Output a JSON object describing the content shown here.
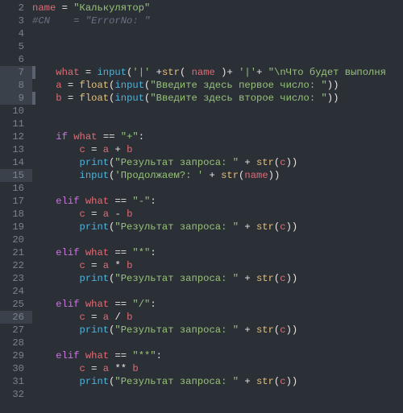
{
  "lines": [
    {
      "n": 2,
      "cls": "",
      "tokens": [
        {
          "c": "var",
          "t": "name"
        },
        {
          "c": "op",
          "t": " = "
        },
        {
          "c": "str",
          "t": "\"Калькулятор\""
        }
      ]
    },
    {
      "n": 3,
      "cls": "",
      "tokens": [
        {
          "c": "cmt",
          "t": "#CN    = \"ErrorNo: \""
        }
      ]
    },
    {
      "n": 4,
      "cls": "",
      "tokens": [
        {
          "c": "op",
          "t": ""
        }
      ]
    },
    {
      "n": 5,
      "cls": "",
      "tokens": [
        {
          "c": "op",
          "t": ""
        }
      ]
    },
    {
      "n": 6,
      "cls": "",
      "tokens": [
        {
          "c": "op",
          "t": ""
        }
      ]
    },
    {
      "n": 7,
      "cls": "hl0",
      "tokens": [
        {
          "c": "op",
          "t": "    "
        },
        {
          "c": "var",
          "t": "what"
        },
        {
          "c": "op",
          "t": " = "
        },
        {
          "c": "fn",
          "t": "input"
        },
        {
          "c": "op",
          "t": "("
        },
        {
          "c": "str",
          "t": "'|'"
        },
        {
          "c": "op",
          "t": " +"
        },
        {
          "c": "ty",
          "t": "str"
        },
        {
          "c": "op",
          "t": "( "
        },
        {
          "c": "var",
          "t": "name"
        },
        {
          "c": "op",
          "t": " )+ "
        },
        {
          "c": "str",
          "t": "'|'"
        },
        {
          "c": "op",
          "t": "+ "
        },
        {
          "c": "str",
          "t": "\"\\nЧто будет выполня"
        }
      ]
    },
    {
      "n": 8,
      "cls": "hl1",
      "tokens": [
        {
          "c": "op",
          "t": "    "
        },
        {
          "c": "var",
          "t": "a"
        },
        {
          "c": "op",
          "t": " = "
        },
        {
          "c": "ty",
          "t": "float"
        },
        {
          "c": "op",
          "t": "("
        },
        {
          "c": "fn",
          "t": "input"
        },
        {
          "c": "op",
          "t": "("
        },
        {
          "c": "str",
          "t": "\"Введите здесь первое число: \""
        },
        {
          "c": "op",
          "t": "))"
        }
      ]
    },
    {
      "n": 9,
      "cls": "hl2",
      "tokens": [
        {
          "c": "op",
          "t": "    "
        },
        {
          "c": "var",
          "t": "b"
        },
        {
          "c": "op",
          "t": " = "
        },
        {
          "c": "ty",
          "t": "float"
        },
        {
          "c": "op",
          "t": "("
        },
        {
          "c": "fn",
          "t": "input"
        },
        {
          "c": "op",
          "t": "("
        },
        {
          "c": "str",
          "t": "\"Введите здесь второе число: \""
        },
        {
          "c": "op",
          "t": "))"
        }
      ]
    },
    {
      "n": 10,
      "cls": "",
      "tokens": [
        {
          "c": "op",
          "t": ""
        }
      ]
    },
    {
      "n": 11,
      "cls": "",
      "tokens": [
        {
          "c": "op",
          "t": ""
        }
      ]
    },
    {
      "n": 12,
      "cls": "",
      "tokens": [
        {
          "c": "op",
          "t": "    "
        },
        {
          "c": "kw",
          "t": "if"
        },
        {
          "c": "op",
          "t": " "
        },
        {
          "c": "var",
          "t": "what"
        },
        {
          "c": "op",
          "t": " == "
        },
        {
          "c": "str",
          "t": "\"+\""
        },
        {
          "c": "op",
          "t": ":"
        }
      ]
    },
    {
      "n": 13,
      "cls": "",
      "tokens": [
        {
          "c": "op",
          "t": "        "
        },
        {
          "c": "var",
          "t": "c"
        },
        {
          "c": "op",
          "t": " = "
        },
        {
          "c": "var",
          "t": "a"
        },
        {
          "c": "op",
          "t": " + "
        },
        {
          "c": "var",
          "t": "b"
        }
      ]
    },
    {
      "n": 14,
      "cls": "",
      "tokens": [
        {
          "c": "op",
          "t": "        "
        },
        {
          "c": "fn",
          "t": "print"
        },
        {
          "c": "op",
          "t": "("
        },
        {
          "c": "str",
          "t": "\"Результат запроса: \""
        },
        {
          "c": "op",
          "t": " + "
        },
        {
          "c": "ty",
          "t": "str"
        },
        {
          "c": "op",
          "t": "("
        },
        {
          "c": "var",
          "t": "c"
        },
        {
          "c": "op",
          "t": "))"
        }
      ]
    },
    {
      "n": 15,
      "cls": "hl1",
      "tokens": [
        {
          "c": "op",
          "t": "        "
        },
        {
          "c": "fn",
          "t": "input"
        },
        {
          "c": "op",
          "t": "("
        },
        {
          "c": "str",
          "t": "'Продолжаем?: '"
        },
        {
          "c": "op",
          "t": " + "
        },
        {
          "c": "ty",
          "t": "str"
        },
        {
          "c": "op",
          "t": "("
        },
        {
          "c": "var",
          "t": "name"
        },
        {
          "c": "op",
          "t": "))"
        }
      ]
    },
    {
      "n": 16,
      "cls": "",
      "tokens": [
        {
          "c": "op",
          "t": ""
        }
      ]
    },
    {
      "n": 17,
      "cls": "",
      "tokens": [
        {
          "c": "op",
          "t": "    "
        },
        {
          "c": "kw",
          "t": "elif"
        },
        {
          "c": "op",
          "t": " "
        },
        {
          "c": "var",
          "t": "what"
        },
        {
          "c": "op",
          "t": " == "
        },
        {
          "c": "str",
          "t": "\"-\""
        },
        {
          "c": "op",
          "t": ":"
        }
      ]
    },
    {
      "n": 18,
      "cls": "",
      "tokens": [
        {
          "c": "op",
          "t": "        "
        },
        {
          "c": "var",
          "t": "c"
        },
        {
          "c": "op",
          "t": " = "
        },
        {
          "c": "var",
          "t": "a"
        },
        {
          "c": "op",
          "t": " - "
        },
        {
          "c": "var",
          "t": "b"
        }
      ]
    },
    {
      "n": 19,
      "cls": "",
      "tokens": [
        {
          "c": "op",
          "t": "        "
        },
        {
          "c": "fn",
          "t": "print"
        },
        {
          "c": "op",
          "t": "("
        },
        {
          "c": "str",
          "t": "\"Результат запроса: \""
        },
        {
          "c": "op",
          "t": " + "
        },
        {
          "c": "ty",
          "t": "str"
        },
        {
          "c": "op",
          "t": "("
        },
        {
          "c": "var",
          "t": "c"
        },
        {
          "c": "op",
          "t": "))"
        }
      ]
    },
    {
      "n": 20,
      "cls": "",
      "tokens": [
        {
          "c": "op",
          "t": ""
        }
      ]
    },
    {
      "n": 21,
      "cls": "",
      "tokens": [
        {
          "c": "op",
          "t": "    "
        },
        {
          "c": "kw",
          "t": "elif"
        },
        {
          "c": "op",
          "t": " "
        },
        {
          "c": "var",
          "t": "what"
        },
        {
          "c": "op",
          "t": " == "
        },
        {
          "c": "str",
          "t": "\"*\""
        },
        {
          "c": "op",
          "t": ":"
        }
      ]
    },
    {
      "n": 22,
      "cls": "",
      "tokens": [
        {
          "c": "op",
          "t": "        "
        },
        {
          "c": "var",
          "t": "c"
        },
        {
          "c": "op",
          "t": " = "
        },
        {
          "c": "var",
          "t": "a"
        },
        {
          "c": "op",
          "t": " * "
        },
        {
          "c": "var",
          "t": "b"
        }
      ]
    },
    {
      "n": 23,
      "cls": "",
      "tokens": [
        {
          "c": "op",
          "t": "        "
        },
        {
          "c": "fn",
          "t": "print"
        },
        {
          "c": "op",
          "t": "("
        },
        {
          "c": "str",
          "t": "\"Результат запроса: \""
        },
        {
          "c": "op",
          "t": " + "
        },
        {
          "c": "ty",
          "t": "str"
        },
        {
          "c": "op",
          "t": "("
        },
        {
          "c": "var",
          "t": "c"
        },
        {
          "c": "op",
          "t": "))"
        }
      ]
    },
    {
      "n": 24,
      "cls": "",
      "tokens": [
        {
          "c": "op",
          "t": ""
        }
      ]
    },
    {
      "n": 25,
      "cls": "",
      "tokens": [
        {
          "c": "op",
          "t": "    "
        },
        {
          "c": "kw",
          "t": "elif"
        },
        {
          "c": "op",
          "t": " "
        },
        {
          "c": "var",
          "t": "what"
        },
        {
          "c": "op",
          "t": " == "
        },
        {
          "c": "str",
          "t": "\"/\""
        },
        {
          "c": "op",
          "t": ":"
        }
      ]
    },
    {
      "n": 26,
      "cls": "hl1",
      "tokens": [
        {
          "c": "op",
          "t": "        "
        },
        {
          "c": "var",
          "t": "c"
        },
        {
          "c": "op",
          "t": " = "
        },
        {
          "c": "var",
          "t": "a"
        },
        {
          "c": "op",
          "t": " / "
        },
        {
          "c": "var",
          "t": "b"
        }
      ]
    },
    {
      "n": 27,
      "cls": "",
      "tokens": [
        {
          "c": "op",
          "t": "        "
        },
        {
          "c": "fn",
          "t": "print"
        },
        {
          "c": "op",
          "t": "("
        },
        {
          "c": "str",
          "t": "\"Результат запроса: \""
        },
        {
          "c": "op",
          "t": " + "
        },
        {
          "c": "ty",
          "t": "str"
        },
        {
          "c": "op",
          "t": "("
        },
        {
          "c": "var",
          "t": "c"
        },
        {
          "c": "op",
          "t": "))"
        }
      ]
    },
    {
      "n": 28,
      "cls": "",
      "tokens": [
        {
          "c": "op",
          "t": ""
        }
      ]
    },
    {
      "n": 29,
      "cls": "",
      "tokens": [
        {
          "c": "op",
          "t": "    "
        },
        {
          "c": "kw",
          "t": "elif"
        },
        {
          "c": "op",
          "t": " "
        },
        {
          "c": "var",
          "t": "what"
        },
        {
          "c": "op",
          "t": " == "
        },
        {
          "c": "str",
          "t": "\"**\""
        },
        {
          "c": "op",
          "t": ":"
        }
      ]
    },
    {
      "n": 30,
      "cls": "",
      "tokens": [
        {
          "c": "op",
          "t": "        "
        },
        {
          "c": "var",
          "t": "c"
        },
        {
          "c": "op",
          "t": " = "
        },
        {
          "c": "var",
          "t": "a"
        },
        {
          "c": "op",
          "t": " ** "
        },
        {
          "c": "var",
          "t": "b"
        }
      ]
    },
    {
      "n": 31,
      "cls": "",
      "tokens": [
        {
          "c": "op",
          "t": "        "
        },
        {
          "c": "fn",
          "t": "print"
        },
        {
          "c": "op",
          "t": "("
        },
        {
          "c": "str",
          "t": "\"Результат запроса: \""
        },
        {
          "c": "op",
          "t": " + "
        },
        {
          "c": "ty",
          "t": "str"
        },
        {
          "c": "op",
          "t": "("
        },
        {
          "c": "var",
          "t": "c"
        },
        {
          "c": "op",
          "t": "))"
        }
      ]
    },
    {
      "n": 32,
      "cls": "",
      "tokens": [
        {
          "c": "op",
          "t": ""
        }
      ]
    }
  ]
}
